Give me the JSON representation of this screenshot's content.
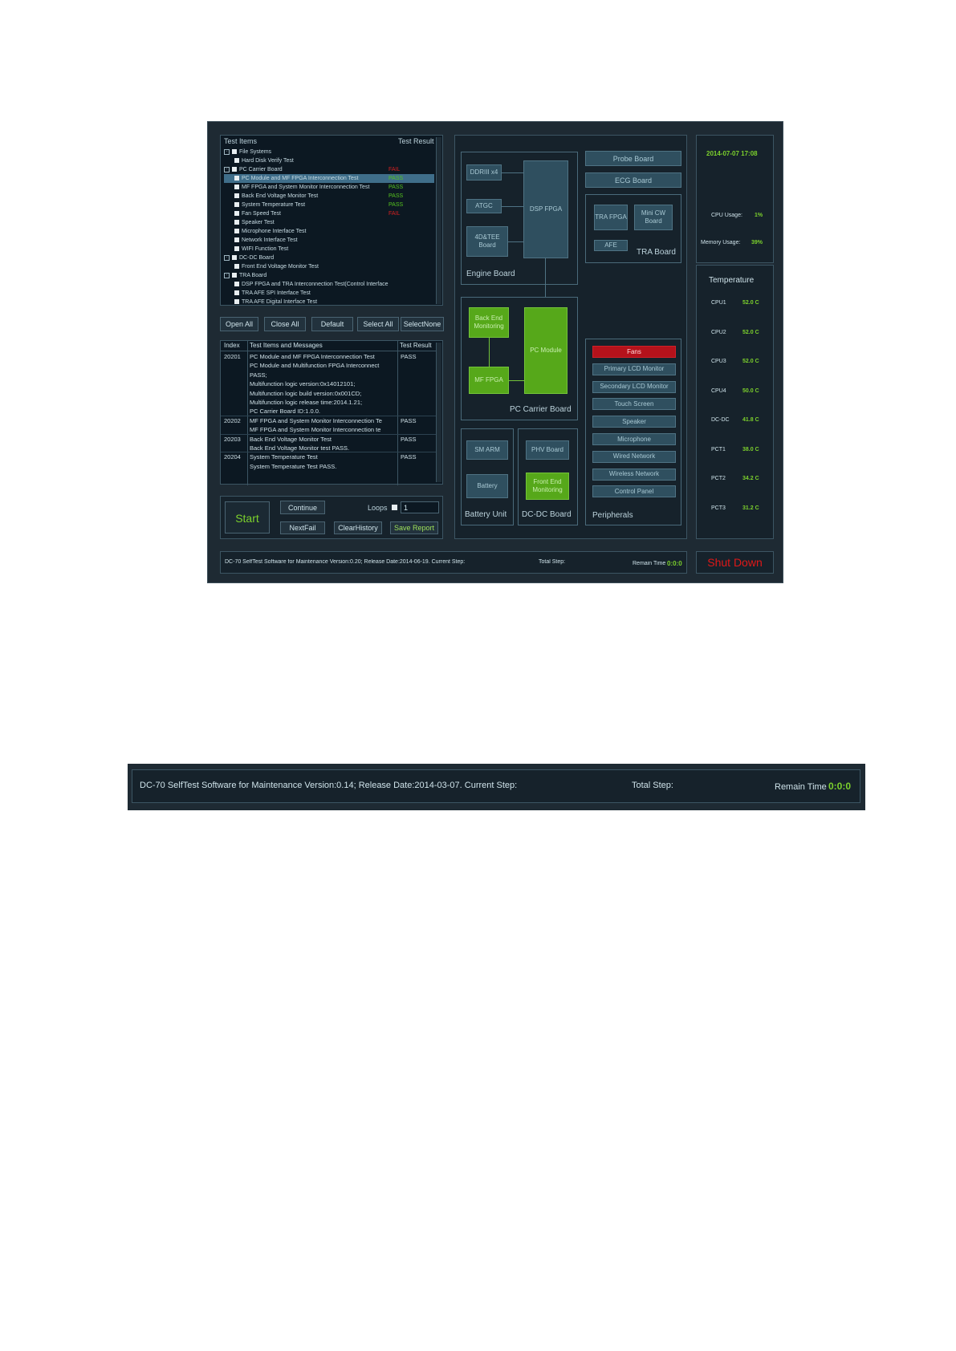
{
  "tree": {
    "header_items": "Test Items",
    "header_result": "Test Result",
    "rows": [
      {
        "label": "File Systems",
        "level": 0,
        "result": "",
        "rclass": ""
      },
      {
        "label": "Hard Disk Verify Test",
        "level": 1,
        "result": "",
        "rclass": ""
      },
      {
        "label": "PC Carrier Board",
        "level": 0,
        "result": "FAIL",
        "rclass": "fail"
      },
      {
        "label": "PC Module and MF FPGA Interconnection Test",
        "level": 1,
        "result": "PASS",
        "rclass": "pass"
      },
      {
        "label": "MF FPGA and System Monitor Interconnection Test",
        "level": 1,
        "result": "PASS",
        "rclass": "pass"
      },
      {
        "label": "Back End Voltage Monitor Test",
        "level": 1,
        "result": "PASS",
        "rclass": "pass"
      },
      {
        "label": "System Temperature Test",
        "level": 1,
        "result": "PASS",
        "rclass": "pass"
      },
      {
        "label": "Fan Speed Test",
        "level": 1,
        "result": "FAIL",
        "rclass": "fail"
      },
      {
        "label": "Speaker Test",
        "level": 1,
        "result": "",
        "rclass": ""
      },
      {
        "label": "Microphone Interface Test",
        "level": 1,
        "result": "",
        "rclass": ""
      },
      {
        "label": "Network Interface Test",
        "level": 1,
        "result": "",
        "rclass": ""
      },
      {
        "label": "WIFI Function Test",
        "level": 1,
        "result": "",
        "rclass": ""
      },
      {
        "label": "DC-DC Board",
        "level": 0,
        "result": "",
        "rclass": ""
      },
      {
        "label": "Front End Voltage Monitor Test",
        "level": 1,
        "result": "",
        "rclass": ""
      },
      {
        "label": "TRA Board",
        "level": 0,
        "result": "",
        "rclass": ""
      },
      {
        "label": "DSP FPGA and TRA Interconnection Test(Control Interface",
        "level": 1,
        "result": "",
        "rclass": ""
      },
      {
        "label": "TRA AFE SPI Interface Test",
        "level": 1,
        "result": "",
        "rclass": ""
      },
      {
        "label": "TRA AFE Digital Interface Test",
        "level": 1,
        "result": "",
        "rclass": ""
      }
    ]
  },
  "tree_buttons": [
    "Open All",
    "Close All",
    "Default",
    "Select All",
    "SelectNone"
  ],
  "messages": {
    "header_index": "Index",
    "header_items": "Test Items and Messages",
    "header_result": "Test Result",
    "rows": [
      {
        "index": "20201",
        "text": "PC Module and MF FPGA Interconnection Test",
        "result": "PASS"
      },
      {
        "index": "",
        "text": "PC Module and Multifunction FPGA Interconnect",
        "result": ""
      },
      {
        "index": "",
        "text": "PASS;",
        "result": ""
      },
      {
        "index": "",
        "text": "Multifunction logic version:0x14012101;",
        "result": ""
      },
      {
        "index": "",
        "text": "Multifunction logic build version:0x001CD;",
        "result": ""
      },
      {
        "index": "",
        "text": "Multifunction logic release time:2014.1.21;",
        "result": ""
      },
      {
        "index": "",
        "text": "PC Carrier Board ID:1.0.0.",
        "result": ""
      },
      {
        "index": "20202",
        "text": "MF FPGA and System Monitor Interconnection Te",
        "result": "PASS"
      },
      {
        "index": "",
        "text": "MF FPGA and System Monitor Interconnection te",
        "result": ""
      },
      {
        "index": "20203",
        "text": "Back End Voltage Monitor Test",
        "result": "PASS"
      },
      {
        "index": "",
        "text": "Back End Voltage Monitor test PASS.",
        "result": ""
      },
      {
        "index": "20204",
        "text": "System Temperature Test",
        "result": "PASS"
      },
      {
        "index": "",
        "text": "System Temperature Test PASS.",
        "result": ""
      }
    ]
  },
  "controls": {
    "start": "Start",
    "continue": "Continue",
    "loops_label": "Loops",
    "loops_value": "1",
    "nextfail": "NextFail",
    "clearhistory": "ClearHistory",
    "save_report": "Save Report"
  },
  "diagram": {
    "engine": {
      "title": "Engine Board",
      "ddr": "DDRIII x4",
      "atgc": "ATGC",
      "tee": "4D&TEE Board",
      "dsp": "DSP FPGA"
    },
    "probe": "Probe Board",
    "ecg": "ECG Board",
    "tra": {
      "title": "TRA Board",
      "fpga": "TRA FPGA",
      "minicw": "Mini CW Board",
      "afe": "AFE"
    },
    "pc": {
      "title": "PC Carrier Board",
      "backend": "Back End Monitoring",
      "mf": "MF FPGA",
      "module": "PC Module"
    },
    "battery": {
      "title": "Battery Unit",
      "smarm": "SM ARM",
      "battery": "Battery"
    },
    "dcdc": {
      "title": "DC-DC Board",
      "phv": "PHV Board",
      "frontend": "Front End Monitoring"
    },
    "peripherals": {
      "title": "Peripherals",
      "items": [
        "Fans",
        "Primary LCD Monitor",
        "Secondary LCD Monitor",
        "Touch Screen",
        "Speaker",
        "Microphone",
        "Wired Network",
        "Wireless Network",
        "Control Panel"
      ]
    }
  },
  "status": {
    "datetime": "2014-07-07 17:08",
    "cpu_label": "CPU Usage:",
    "cpu_value": "1%",
    "mem_label": "Memory Usage:",
    "mem_value": "39%"
  },
  "temperature": {
    "title": "Temperature",
    "rows": [
      {
        "name": "CPU1",
        "value": "52.0 C"
      },
      {
        "name": "CPU2",
        "value": "52.0 C"
      },
      {
        "name": "CPU3",
        "value": "52.0 C"
      },
      {
        "name": "CPU4",
        "value": "50.0 C"
      },
      {
        "name": "DC-DC",
        "value": "41.8 C"
      },
      {
        "name": "PCT1",
        "value": "38.0 C"
      },
      {
        "name": "PCT2",
        "value": "34.2 C"
      },
      {
        "name": "PCT3",
        "value": "31.2 C"
      }
    ]
  },
  "footer": {
    "info": "DC-70 SelfTest Software for Maintenance Version:0.20; Release Date:2014-06-19.  Current Step:",
    "total": "Total Step:",
    "remain_label": "Remain Time",
    "remain_value": "0:0:0",
    "shutdown": "Shut Down"
  },
  "bar": {
    "info": "DC-70 SelfTest Software for Maintenance Version:0.14; Release Date:2014-03-07.  Current Step:",
    "total": "Total Step:",
    "remain_label": "Remain Time",
    "remain_value": "0:0:0"
  },
  "colors": {
    "pass": "#55c21f",
    "fail": "#d62020",
    "accent_green": "#56a81a",
    "alert_red": "#b5121b"
  }
}
